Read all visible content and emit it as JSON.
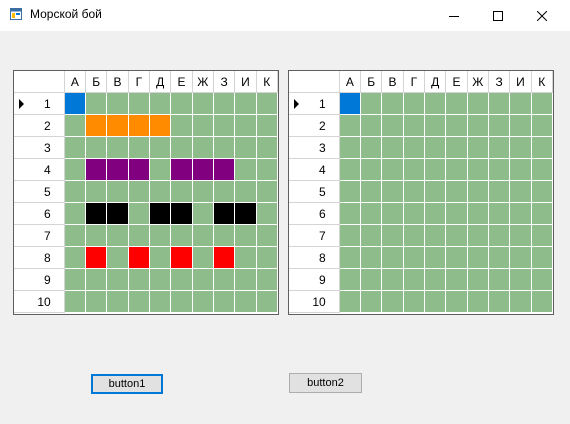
{
  "window": {
    "title": "Морской бой"
  },
  "columns": [
    "А",
    "Б",
    "В",
    "Г",
    "Д",
    "Е",
    "Ж",
    "З",
    "И",
    "К"
  ],
  "rows": [
    "1",
    "2",
    "3",
    "4",
    "5",
    "6",
    "7",
    "8",
    "9",
    "10"
  ],
  "colors": {
    "water": "#8fbc8b",
    "selected": "#0078d7",
    "orange": "#ff8c00",
    "purple": "#800080",
    "black": "#000000",
    "red": "#ff0000"
  },
  "left_board": {
    "current_row": "1",
    "cells": [
      [
        "sel",
        "",
        "",
        "",
        "",
        "",
        "",
        "",
        "",
        ""
      ],
      [
        "",
        "orange",
        "orange",
        "orange",
        "orange",
        "",
        "",
        "",
        "",
        ""
      ],
      [
        "",
        "",
        "",
        "",
        "",
        "",
        "",
        "",
        "",
        ""
      ],
      [
        "",
        "purple",
        "purple",
        "purple",
        "",
        "purple",
        "purple",
        "purple",
        "",
        ""
      ],
      [
        "",
        "",
        "",
        "",
        "",
        "",
        "",
        "",
        "",
        ""
      ],
      [
        "",
        "black",
        "black",
        "",
        "black",
        "black",
        "",
        "black",
        "black",
        ""
      ],
      [
        "",
        "",
        "",
        "",
        "",
        "",
        "",
        "",
        "",
        ""
      ],
      [
        "",
        "red",
        "",
        "red",
        "",
        "red",
        "",
        "red",
        "",
        ""
      ],
      [
        "",
        "",
        "",
        "",
        "",
        "",
        "",
        "",
        "",
        ""
      ],
      [
        "",
        "",
        "",
        "",
        "",
        "",
        "",
        "",
        "",
        ""
      ]
    ]
  },
  "right_board": {
    "current_row": "1",
    "cells": [
      [
        "sel",
        "",
        "",
        "",
        "",
        "",
        "",
        "",
        "",
        ""
      ],
      [
        "",
        "",
        "",
        "",
        "",
        "",
        "",
        "",
        "",
        ""
      ],
      [
        "",
        "",
        "",
        "",
        "",
        "",
        "",
        "",
        "",
        ""
      ],
      [
        "",
        "",
        "",
        "",
        "",
        "",
        "",
        "",
        "",
        ""
      ],
      [
        "",
        "",
        "",
        "",
        "",
        "",
        "",
        "",
        "",
        ""
      ],
      [
        "",
        "",
        "",
        "",
        "",
        "",
        "",
        "",
        "",
        ""
      ],
      [
        "",
        "",
        "",
        "",
        "",
        "",
        "",
        "",
        "",
        ""
      ],
      [
        "",
        "",
        "",
        "",
        "",
        "",
        "",
        "",
        "",
        ""
      ],
      [
        "",
        "",
        "",
        "",
        "",
        "",
        "",
        "",
        "",
        ""
      ],
      [
        "",
        "",
        "",
        "",
        "",
        "",
        "",
        "",
        "",
        ""
      ]
    ]
  },
  "buttons": {
    "button1": "button1",
    "button2": "button2"
  },
  "icons": {
    "app": "battleship-app-icon",
    "minimize": "minimize-icon",
    "maximize": "maximize-icon",
    "close": "close-icon"
  }
}
